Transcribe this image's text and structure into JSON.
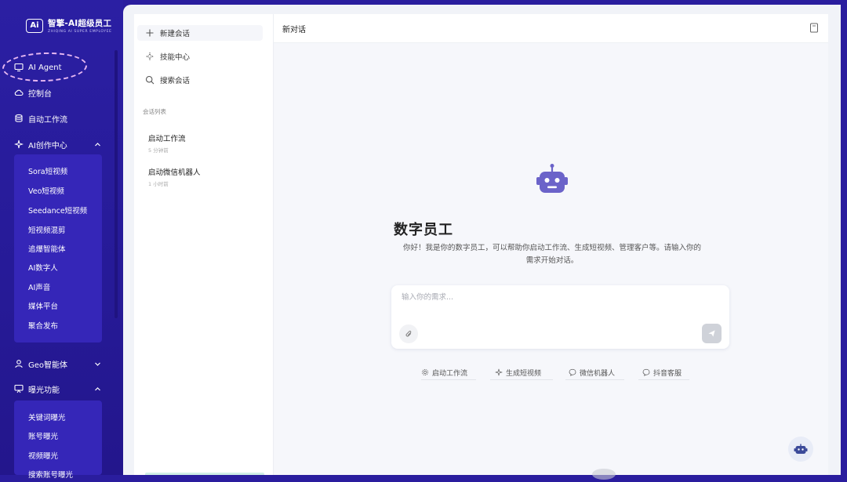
{
  "brand": {
    "name": "智擎-AI超级员工",
    "subtitle": "ZHIQING AI SUPER EMPLOYEE",
    "logo": "Ai"
  },
  "nav": {
    "items": [
      {
        "label": "AI Agent",
        "icon": "monitor-icon"
      },
      {
        "label": "控制台",
        "icon": "cloud-icon"
      },
      {
        "label": "自动工作流",
        "icon": "workflow-icon"
      },
      {
        "label": "AI创作中心",
        "icon": "sparkle-icon",
        "expanded": true
      },
      {
        "label": "Geo智能体",
        "icon": "user-icon",
        "expanded": false
      },
      {
        "label": "曝光功能",
        "icon": "exposure-icon",
        "expanded": true
      }
    ],
    "ai_creation_sub": [
      "Sora短视频",
      "Veo短视频",
      "Seedance短视频",
      "短视频混剪",
      "追爆智能体",
      "AI数字人",
      "AI声音",
      "媒体平台",
      "聚合发布"
    ],
    "exposure_sub": [
      "关键词曝光",
      "账号曝光",
      "视频曝光",
      "搜索账号曝光"
    ]
  },
  "chat_sidebar": {
    "actions": [
      {
        "label": "新建会话",
        "icon": "plus-icon"
      },
      {
        "label": "技能中心",
        "icon": "sparkle-icon"
      },
      {
        "label": "搜索会话",
        "icon": "search-icon"
      }
    ],
    "section_label": "会话列表",
    "sessions": [
      {
        "title": "启动工作流",
        "time": "5 分钟前"
      },
      {
        "title": "启动微信机器人",
        "time": "1 小时前"
      }
    ]
  },
  "header": {
    "title": "新对话",
    "icon": "document-icon"
  },
  "welcome": {
    "title": "数字员工",
    "desc_line1": "你好！我是你的数字员工，可以帮助你启动工作流、生成短视频、管理客户等。请输入你的",
    "desc_line2": "需求开始对话。"
  },
  "input": {
    "placeholder": "输入你的需求...",
    "value": ""
  },
  "suggestions": [
    {
      "label": "启动工作流",
      "icon": "gear-icon"
    },
    {
      "label": "生成短视频",
      "icon": "sparkle-icon"
    },
    {
      "label": "微信机器人",
      "icon": "chat-icon"
    },
    {
      "label": "抖音客服",
      "icon": "chat-icon"
    }
  ],
  "colors": {
    "nav_bg": "#2b1fa3",
    "nav_panel": "#3526b8",
    "highlight": "#e7b8f2",
    "robot": "#6b63c9"
  }
}
